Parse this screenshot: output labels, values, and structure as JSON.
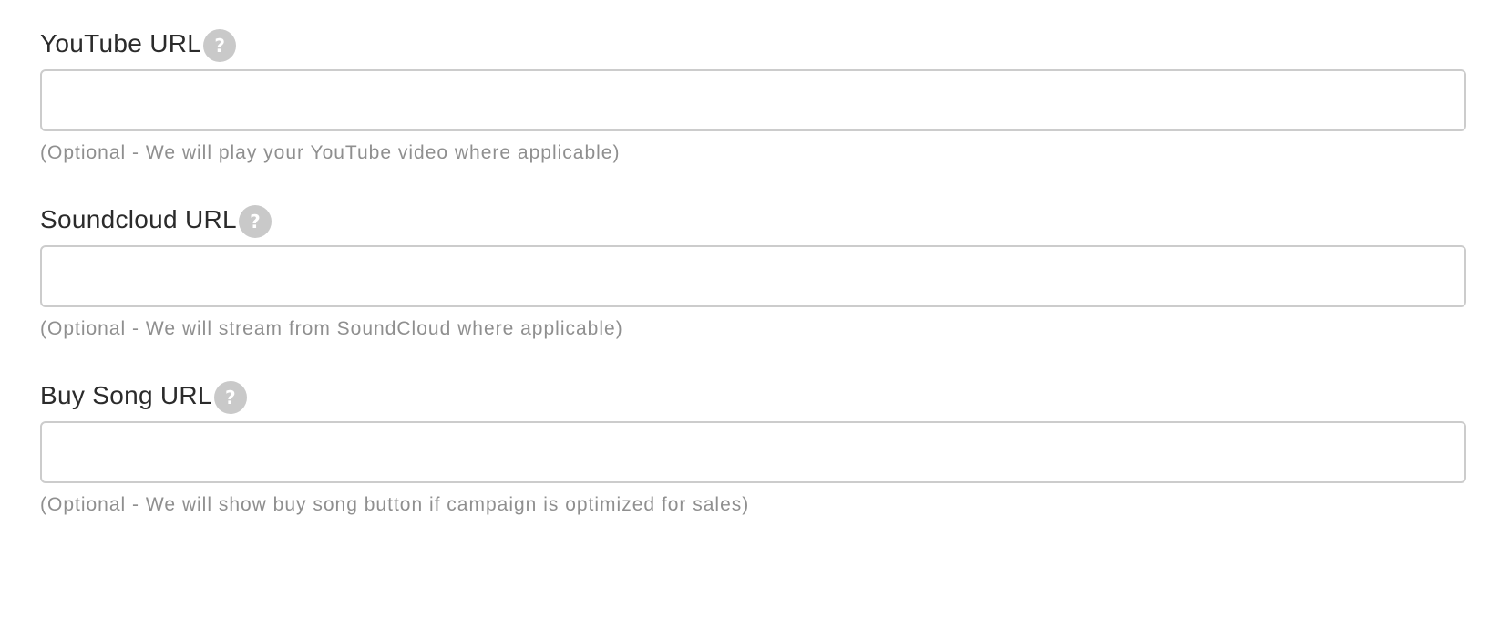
{
  "fields": [
    {
      "label": "YouTube URL",
      "help_icon": "question-mark-icon",
      "value": "",
      "hint": "(Optional - We will play your YouTube video where applicable)"
    },
    {
      "label": "Soundcloud URL",
      "help_icon": "question-mark-icon",
      "value": "",
      "hint": "(Optional - We will stream from SoundCloud where applicable)"
    },
    {
      "label": "Buy Song URL",
      "help_icon": "question-mark-icon",
      "value": "",
      "hint": "(Optional - We will show buy song button if campaign is optimized for sales)"
    }
  ],
  "help_icon_glyph": "?",
  "colors": {
    "label": "#2b2b2b",
    "hint": "#8f8f8f",
    "help_icon_bg": "#c9c9c9",
    "input_border": "#cccccc"
  }
}
